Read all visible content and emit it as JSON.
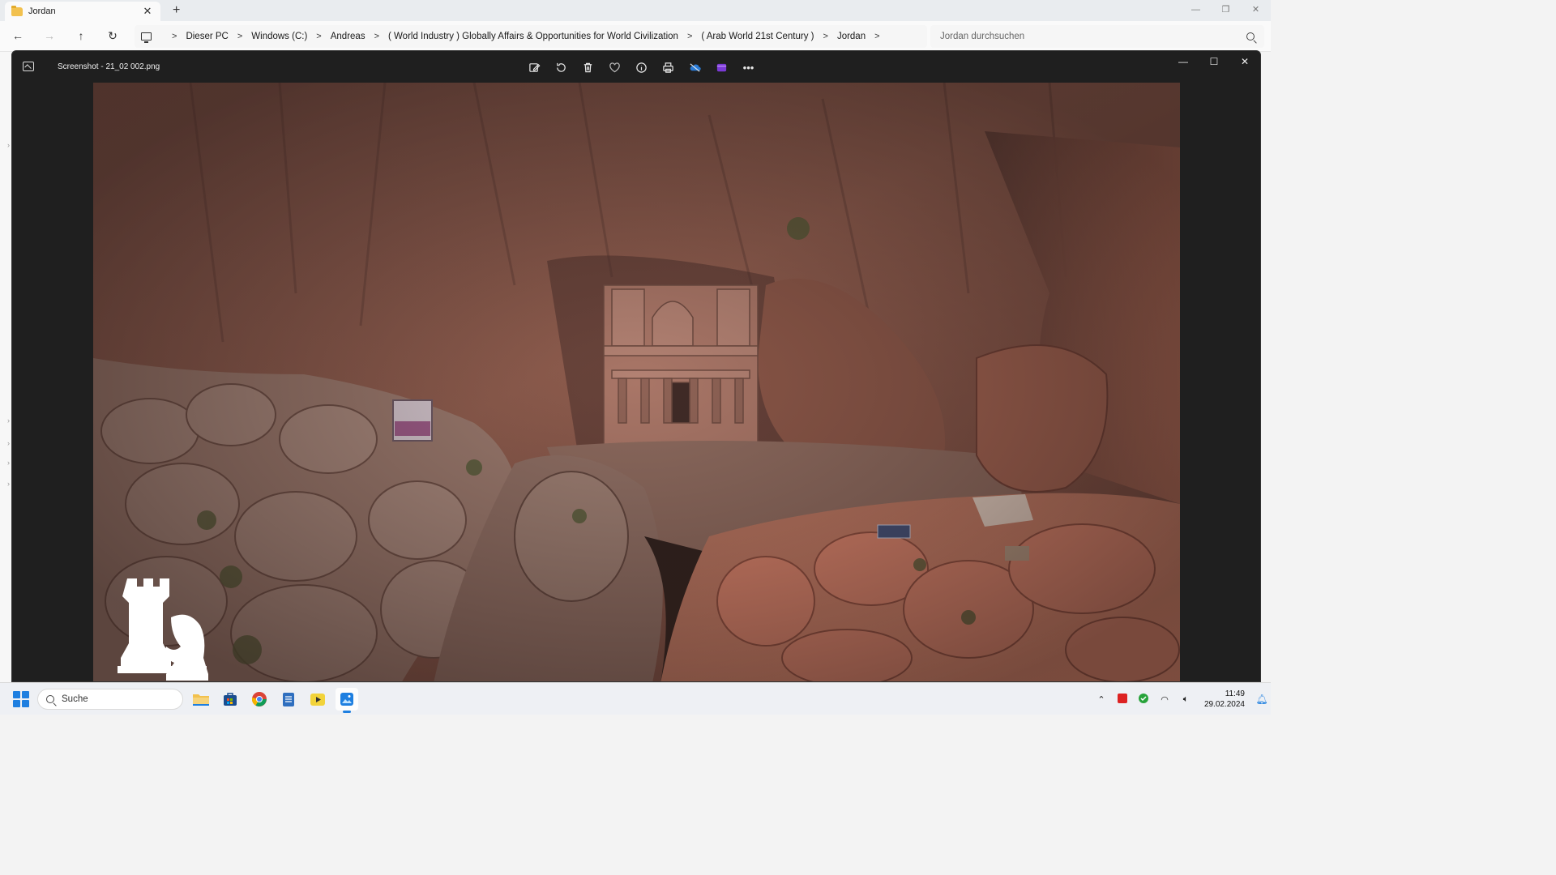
{
  "explorer": {
    "tab_title": "Jordan",
    "new_tab_label": "+",
    "breadcrumb": [
      "Dieser PC",
      "Windows (C:)",
      "Andreas",
      "( World Industry ) Globally Affairs & Opportunities for World Civilization",
      "( Arab World 21st Century )",
      "Jordan"
    ],
    "search_placeholder": "Jordan durchsuchen"
  },
  "viewer": {
    "filename": "Screenshot - 21_02 002.png",
    "toolbar_icons": [
      "edit-image-icon",
      "rotate-icon",
      "delete-icon",
      "favorite-icon",
      "info-icon",
      "print-icon",
      "onedrive-icon",
      "clipchamp-icon",
      "more-icon"
    ],
    "photo_subject": "Aerial view of Al-Khazneh (The Treasury) in Petra, Jordan, carved into rose-red sandstone cliffs",
    "logo": "chess-rook-knight-watermark"
  },
  "taskbar": {
    "search_label": "Suche",
    "apps": [
      "file-explorer-icon",
      "microsoft-store-icon",
      "chrome-icon",
      "notepad-icon",
      "player-icon",
      "photos-icon"
    ],
    "time": "11:49",
    "date": "29.02.2024"
  },
  "colors": {
    "viewer_bg": "#1f1f1f",
    "accent": "#1e7fe0",
    "rock": "#9a6252"
  }
}
